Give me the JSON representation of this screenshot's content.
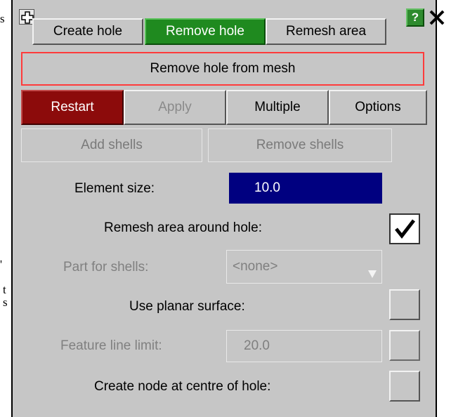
{
  "background_text": {
    "line1": "s",
    "line2": "t",
    "line3": "s",
    "line4": "'"
  },
  "tabs": [
    {
      "label": "Create hole",
      "active": false
    },
    {
      "label": "Remove hole",
      "active": true
    },
    {
      "label": "Remesh area",
      "active": false
    }
  ],
  "window": {
    "help_label": "?",
    "close_label": "✕"
  },
  "panel_title": "Remove hole from mesh",
  "actions": {
    "restart": "Restart",
    "apply": "Apply",
    "multiple": "Multiple",
    "options": "Options"
  },
  "shell_actions": {
    "add": "Add shells",
    "remove": "Remove shells"
  },
  "fields": {
    "element_size_label": "Element size:",
    "element_size_value": "10.0",
    "remesh_label": "Remesh area around hole:",
    "remesh_checked": true,
    "part_label": "Part for shells:",
    "part_value": "<none>",
    "planar_label": "Use planar surface:",
    "planar_checked": false,
    "feature_label": "Feature line limit:",
    "feature_value": "20.0",
    "feature_checked": false,
    "node_label": "Create node at centre of hole:",
    "node_checked": false
  },
  "colors": {
    "panel_bg": "#c6c6c6",
    "active_tab": "#1f8a1f",
    "restart_button": "#8c0b0b",
    "input_active": "#000080",
    "title_border": "#ff3b3b"
  },
  "icons": [
    "drag-handle-icon",
    "help-icon",
    "close-icon",
    "checkmark-icon",
    "dropdown-arrow-icon"
  ]
}
